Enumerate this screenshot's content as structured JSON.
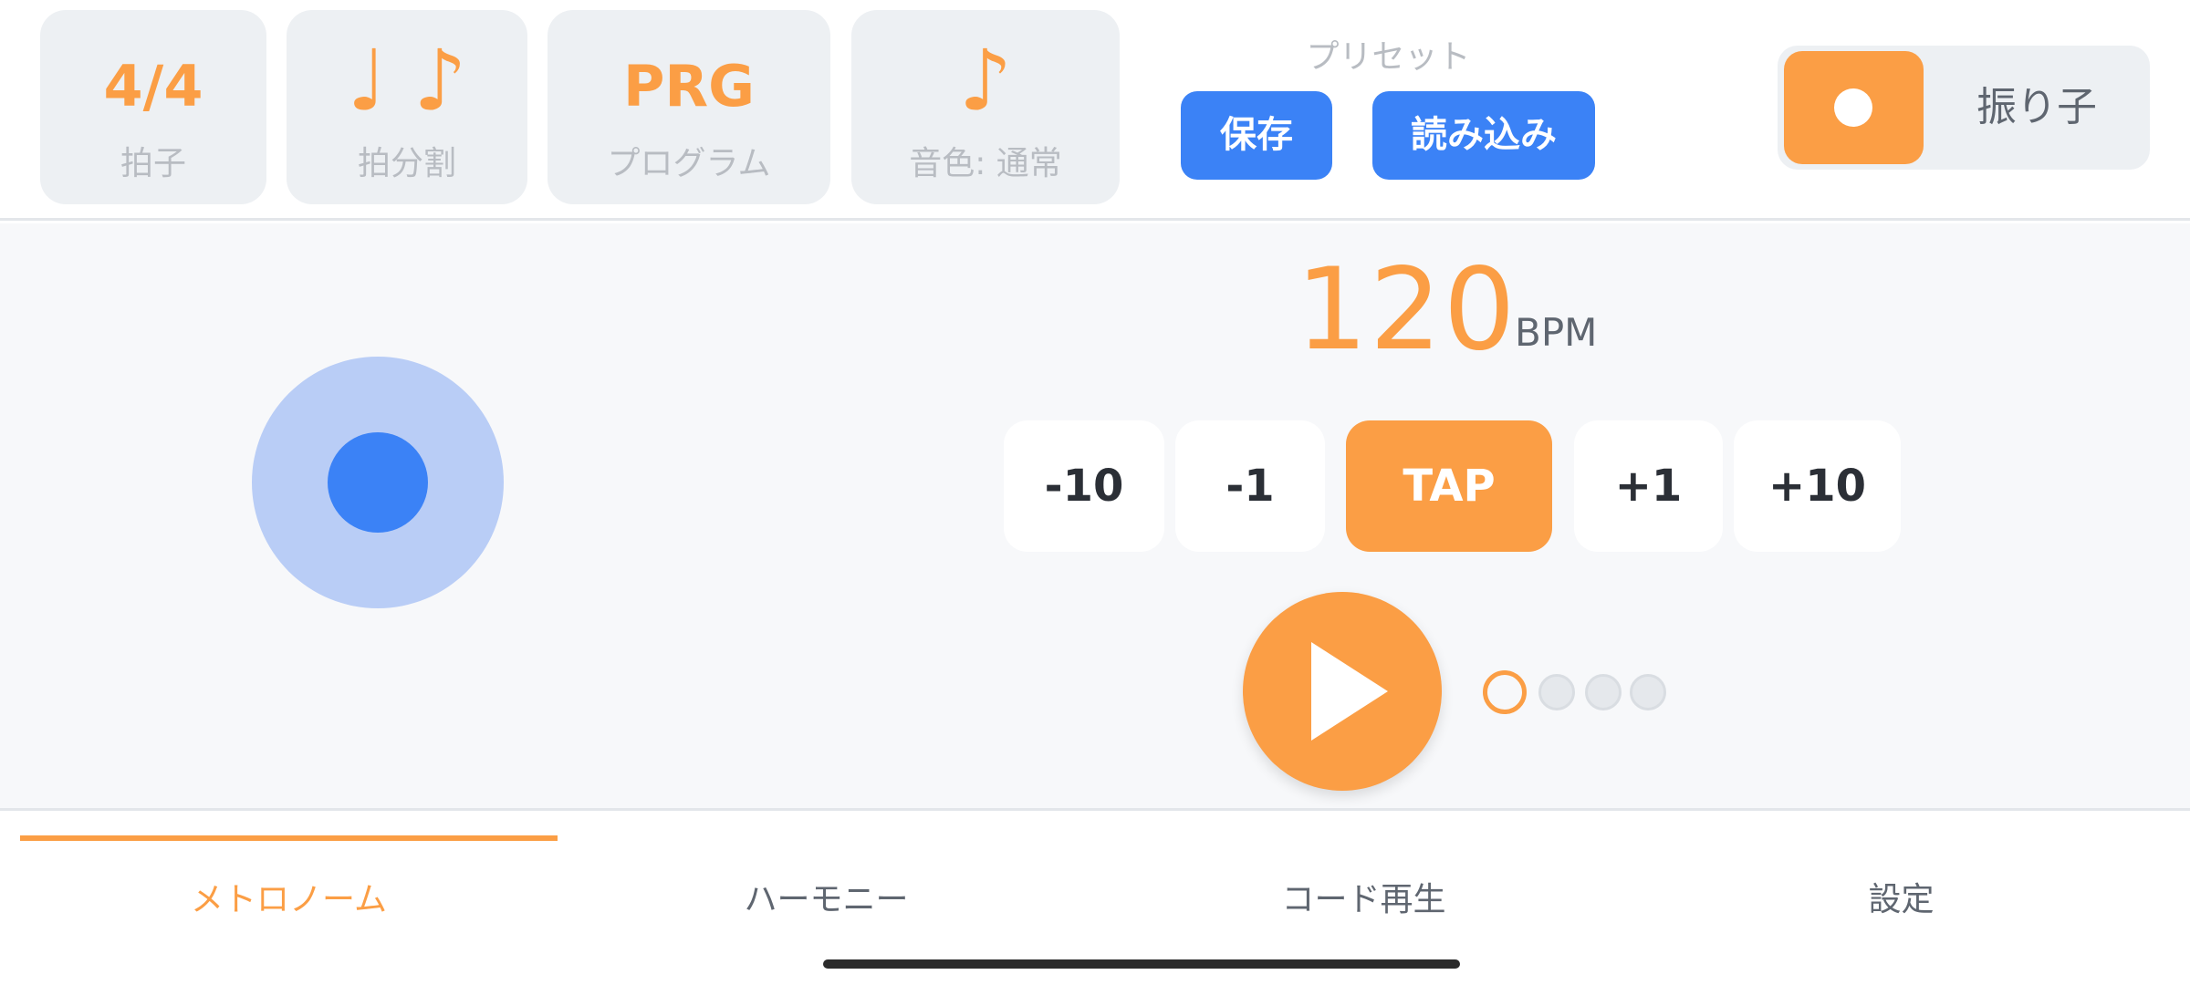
{
  "topbar": {
    "cards": [
      {
        "value": "4/4",
        "label": "拍子"
      },
      {
        "value": "♩ ♪",
        "label": "拍分割"
      },
      {
        "value": "PRG",
        "label": "プログラム"
      },
      {
        "value": "♪",
        "label": "音色: 通常"
      }
    ],
    "preset": {
      "label": "プリセット",
      "save": "保存",
      "load": "読み込み"
    },
    "pendulum": {
      "label": "振り子",
      "on": true
    }
  },
  "tempo": {
    "bpm": "120",
    "unit": "BPM"
  },
  "steppers": [
    "-10",
    "-1",
    "TAP",
    "+1",
    "+10"
  ],
  "beats": {
    "count": 4,
    "current": 1
  },
  "tabs": [
    {
      "label": "メトロノーム",
      "active": true
    },
    {
      "label": "ハーモニー",
      "active": false
    },
    {
      "label": "コード再生",
      "active": false
    },
    {
      "label": "設定",
      "active": false
    }
  ],
  "colors": {
    "accent": "#fb9e45",
    "primary": "#3b82f6"
  }
}
